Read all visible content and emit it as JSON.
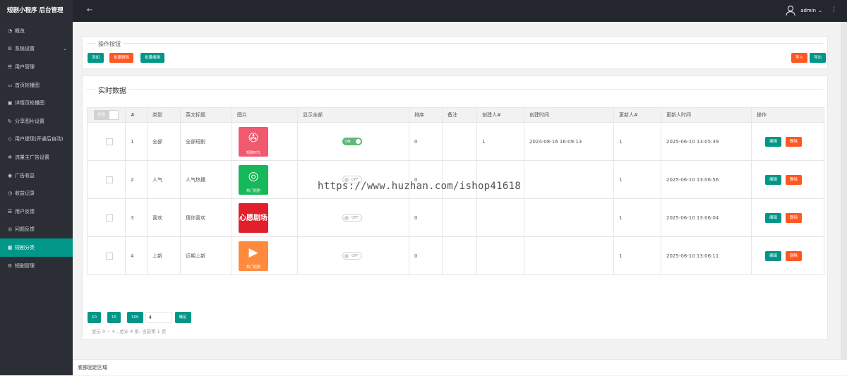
{
  "brand": "短剧小程序 后台管理",
  "sidebar": {
    "items": [
      {
        "label": "概览",
        "icon": "dashboard-icon"
      },
      {
        "label": "系统设置",
        "icon": "gear-icon"
      },
      {
        "label": "用户管理",
        "icon": "user-icon"
      },
      {
        "label": "首页轮播图",
        "icon": "image-icon"
      },
      {
        "label": "详情页轮播图",
        "icon": "image-icon"
      },
      {
        "label": "分享图片设置",
        "icon": "share-icon"
      },
      {
        "label": "用户提现(开通后自动)",
        "icon": "shield-icon"
      },
      {
        "label": "流量主广告设置",
        "icon": "gear-icon"
      },
      {
        "label": "广告收益",
        "icon": "circle-icon"
      },
      {
        "label": "收益记录",
        "icon": "clock-icon"
      },
      {
        "label": "用户反馈",
        "icon": "list-icon"
      },
      {
        "label": "问题反馈",
        "icon": "help-icon"
      },
      {
        "label": "短剧分类",
        "icon": "grid-icon"
      },
      {
        "label": "短剧管理",
        "icon": "settings-icon"
      }
    ]
  },
  "header": {
    "username": "admin"
  },
  "actions": {
    "legend": "操作按钮",
    "add": "添加",
    "batch_delete": "批量删除",
    "batch_edit": "批量编辑",
    "import": "导入",
    "export": "导出"
  },
  "realtime": {
    "legend": "实时数据"
  },
  "table": {
    "select_all": "全选",
    "columns": [
      "#",
      "类型",
      "英文标题",
      "图片",
      "显示全部",
      "排序",
      "备注",
      "创建人#",
      "创建时间",
      "更新人#",
      "更新人时间",
      "操作"
    ],
    "rows": [
      {
        "id": "1",
        "type": "全部",
        "title": "全部短剧",
        "caption": "短剧时光",
        "show_all": "ON",
        "sort": "0",
        "remark": "",
        "creator": "1",
        "created": "2024-08-16 16:09:13",
        "updater": "1",
        "updated": "2025-06-10 13:05:39"
      },
      {
        "id": "2",
        "type": "人气",
        "title": "人气热播",
        "caption": "热门短剧",
        "show_all": "OFF",
        "sort": "0",
        "remark": "",
        "creator": "",
        "created": "",
        "updater": "1",
        "updated": "2025-06-10 13:06:56"
      },
      {
        "id": "3",
        "type": "喜欢",
        "title": "猜你喜欢",
        "caption": "心愿剧场",
        "show_all": "OFF",
        "sort": "0",
        "remark": "",
        "creator": "",
        "created": "",
        "updater": "1",
        "updated": "2025-06-10 13:06:04"
      },
      {
        "id": "4",
        "type": "上新",
        "title": "近期上新",
        "caption": "热门短剧",
        "show_all": "OFF",
        "sort": "0",
        "remark": "",
        "creator": "",
        "created": "",
        "updater": "1",
        "updated": "2025-06-10 13:06:11"
      }
    ],
    "edit": "编辑",
    "delete": "删除"
  },
  "pager": {
    "sizes": [
      "10",
      "15",
      "100"
    ],
    "input": "4",
    "confirm": "确定",
    "info": "显示 0 ~ 4 , 总计 4 条, 当前第 1 页"
  },
  "watermark": "https://www.huzhan.com/ishop41618",
  "footer": "底部固定区域",
  "colors": {
    "teal": "#009688",
    "orange": "#ff5722",
    "sidebar": "#2b2f35",
    "topbar": "#23262e"
  }
}
